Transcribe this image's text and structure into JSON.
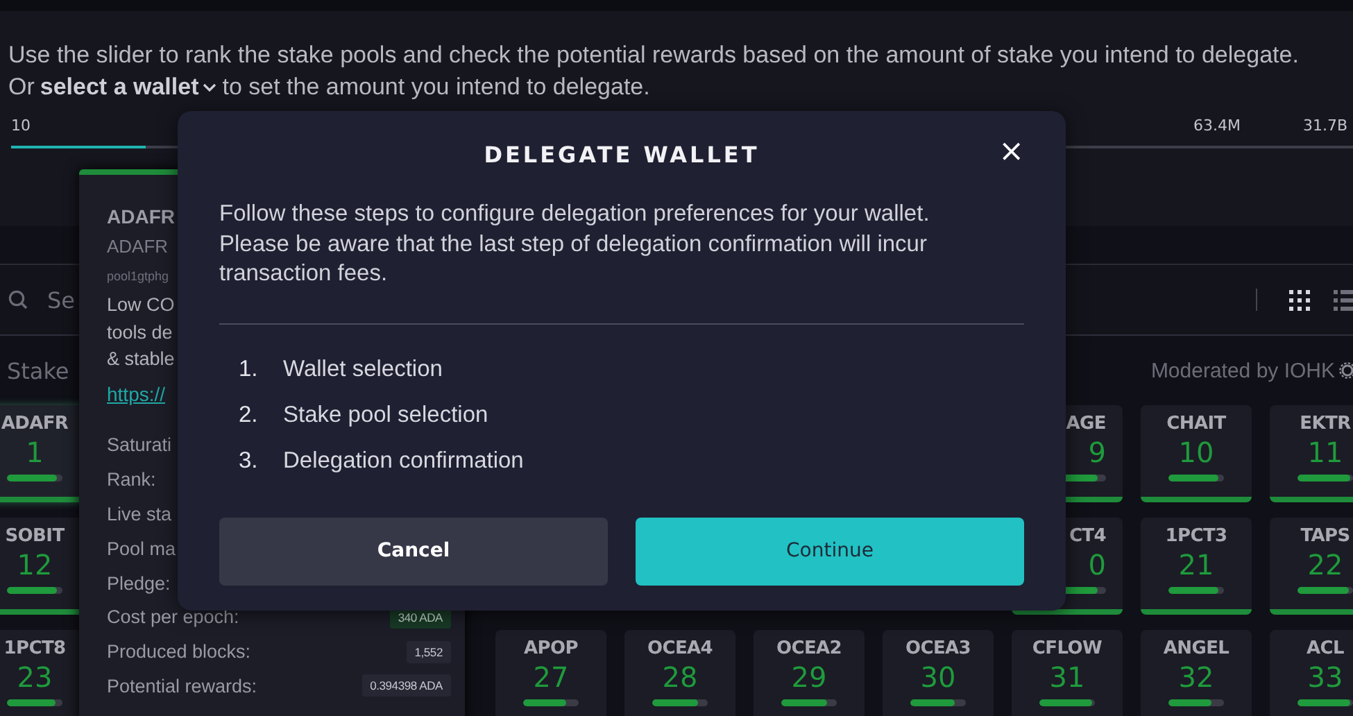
{
  "intro": {
    "line_1": "Use the slider to rank the stake pools and check the potential rewards based on the amount of stake you intend to delegate.",
    "line_2_before": "Or",
    "wallet_link": "select a wallet",
    "line_2_after": "to set the amount you intend to delegate."
  },
  "slider": {
    "min_label": "10",
    "tick_labels": [
      "63.4M",
      "31.7B"
    ],
    "level": 0.1
  },
  "search": {
    "placeholder": "Se"
  },
  "section_title": "Stake",
  "moderated_by": "Moderated by IOHK",
  "pool_rows": [
    [
      {
        "name": "ADAFR",
        "rank": "1",
        "level": 0.9,
        "selected": true
      },
      {
        "name": "AGE",
        "rank": "9",
        "level": 0.85,
        "selected": false,
        "covered": true
      },
      {
        "name": "CHAIT",
        "rank": "10",
        "level": 0.9,
        "selected": false
      },
      {
        "name": "EKTR",
        "rank": "11",
        "level": 0.95,
        "selected": false
      }
    ],
    [
      {
        "name": "SOBIT",
        "rank": "12",
        "level": 0.9,
        "selected": false
      },
      {
        "name": "CT4",
        "rank": "0",
        "level": 0.85,
        "selected": false,
        "covered": true
      },
      {
        "name": "1PCT3",
        "rank": "21",
        "level": 0.9,
        "selected": false
      },
      {
        "name": "TAPS",
        "rank": "22",
        "level": 0.92,
        "selected": false
      }
    ],
    [
      {
        "name": "1PCT8",
        "rank": "23",
        "level": 0.88,
        "selected": false
      },
      {
        "name": "APOP",
        "rank": "27",
        "level": 0.77,
        "selected": false
      },
      {
        "name": "OCEA4",
        "rank": "28",
        "level": 0.82,
        "selected": false
      },
      {
        "name": "OCEA2",
        "rank": "29",
        "level": 0.82,
        "selected": false
      },
      {
        "name": "OCEA3",
        "rank": "30",
        "level": 0.8,
        "selected": false
      },
      {
        "name": "CFLOW",
        "rank": "31",
        "level": 0.95,
        "selected": false
      },
      {
        "name": "ANGEL",
        "rank": "32",
        "level": 0.78,
        "selected": false
      },
      {
        "name": "ACL",
        "rank": "33",
        "level": 0.95,
        "selected": false
      }
    ]
  ],
  "pool_popover": {
    "title": "ADAFR",
    "ticker": "ADAFR",
    "pool_id": "pool1gtphg",
    "description_lines": [
      "Low CO",
      "tools de",
      "& stable"
    ],
    "link": "https://",
    "details": [
      {
        "label": "Saturati"
      },
      {
        "label": "Rank:"
      },
      {
        "label": "Live sta"
      },
      {
        "label": "Pool ma"
      },
      {
        "label": "Pledge:"
      },
      {
        "label": "Cost per epoch:",
        "value": "340 ADA",
        "kind": "highlight"
      },
      {
        "label": "Produced blocks:",
        "value": "1,552",
        "kind": "plain"
      },
      {
        "label": "Potential rewards:",
        "value": "0.394398 ADA",
        "kind": "plain"
      }
    ]
  },
  "dialog": {
    "title": "DELEGATE WALLET",
    "close": "×",
    "description": "Follow these steps to configure delegation preferences for your wallet. Please be aware that the last step of delegation confirmation will incur transaction fees.",
    "steps": [
      {
        "number": "1.",
        "label": "Wallet selection"
      },
      {
        "number": "2.",
        "label": "Stake pool selection"
      },
      {
        "number": "3.",
        "label": "Delegation confirmation"
      }
    ],
    "buttons": [
      {
        "label": "Cancel",
        "kind": "secondary"
      },
      {
        "label": "Continue",
        "kind": "primary"
      }
    ]
  }
}
